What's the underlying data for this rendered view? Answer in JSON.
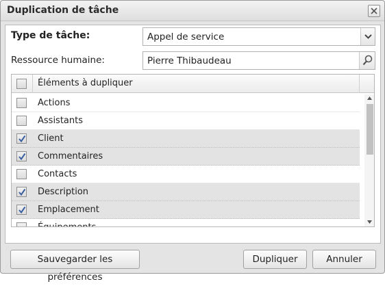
{
  "window": {
    "title": "Duplication de tâche",
    "close_icon": "close-icon"
  },
  "form": {
    "type_label": "Type de tâche:",
    "type_value": "Appel de service",
    "resource_label": "Ressource humaine:",
    "resource_value": "Pierre Thibaudeau"
  },
  "grid": {
    "header_label": "Éléments à dupliquer",
    "header_checked": false,
    "rows": [
      {
        "label": "Actions",
        "checked": false
      },
      {
        "label": "Assistants",
        "checked": false
      },
      {
        "label": "Client",
        "checked": true
      },
      {
        "label": "Commentaires",
        "checked": true
      },
      {
        "label": "Contacts",
        "checked": false
      },
      {
        "label": "Description",
        "checked": true
      },
      {
        "label": "Emplacement",
        "checked": true
      },
      {
        "label": "Équipements",
        "checked": false
      }
    ]
  },
  "footer": {
    "save_prefs_label": "Sauvegarder les préférences",
    "duplicate_label": "Dupliquer",
    "cancel_label": "Annuler"
  },
  "colors": {
    "check": "#3a5fa0",
    "selected_row": "#e3e3e3"
  }
}
